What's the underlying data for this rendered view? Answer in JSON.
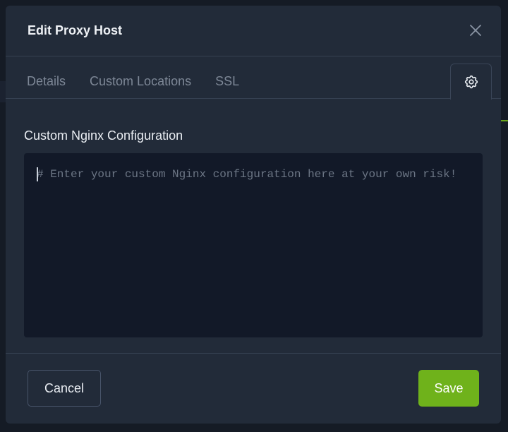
{
  "modal": {
    "title": "Edit Proxy Host"
  },
  "tabs": [
    {
      "label": "Details"
    },
    {
      "label": "Custom Locations"
    },
    {
      "label": "SSL"
    }
  ],
  "settings_tab_icon": "gear-icon",
  "advanced": {
    "section_label": "Custom Nginx Configuration",
    "editor_value": "",
    "editor_placeholder": "# Enter your custom Nginx configuration here at your own risk!"
  },
  "footer": {
    "cancel_label": "Cancel",
    "save_label": "Save"
  },
  "colors": {
    "accent": "#6fb21b",
    "modal_bg": "#222b39",
    "editor_bg": "#121928"
  }
}
